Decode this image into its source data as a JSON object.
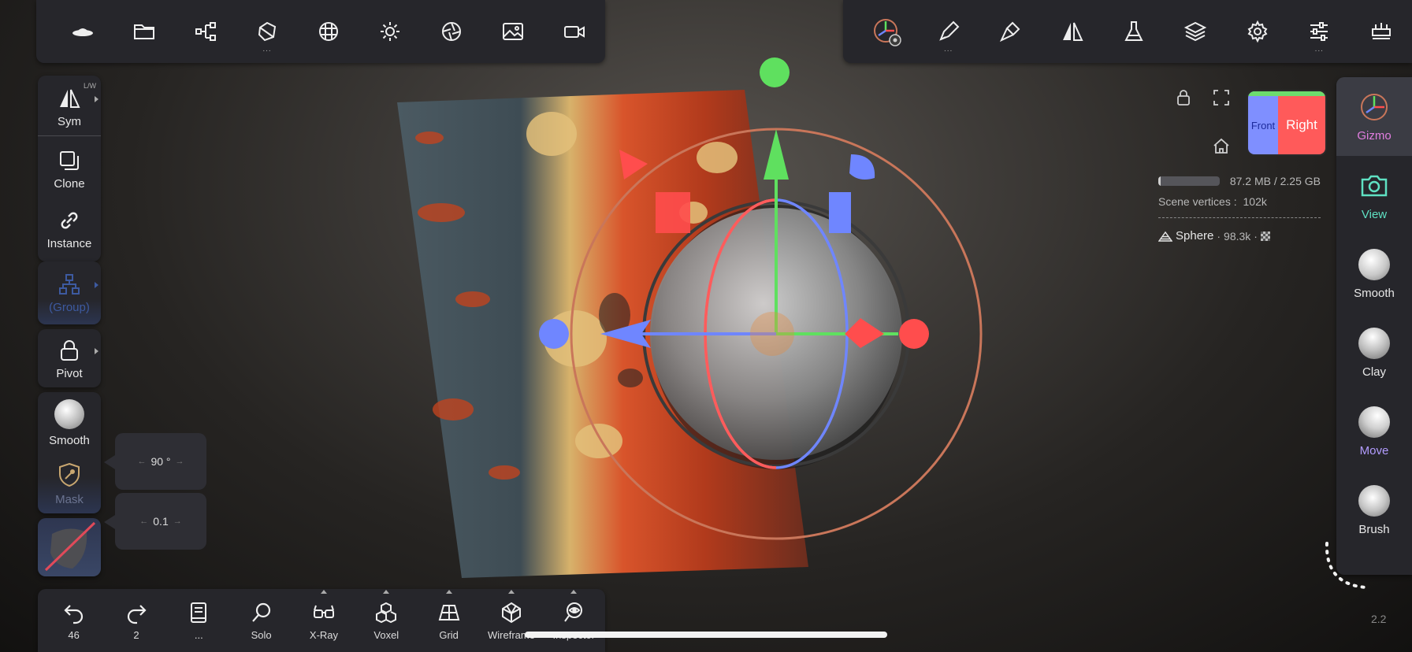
{
  "top_left_toolbar": {
    "items": [
      {
        "name": "scene-icon"
      },
      {
        "name": "folder-icon"
      },
      {
        "name": "node-graph-icon"
      },
      {
        "name": "topology-icon",
        "extra": "..."
      },
      {
        "name": "sphere-grid-icon"
      },
      {
        "name": "sun-icon"
      },
      {
        "name": "aperture-icon"
      },
      {
        "name": "image-icon"
      },
      {
        "name": "video-icon"
      }
    ]
  },
  "top_right_toolbar": {
    "items": [
      {
        "name": "gizmo-settings-icon"
      },
      {
        "name": "pen-icon",
        "extra": "..."
      },
      {
        "name": "brush-icon"
      },
      {
        "name": "symmetry-icon"
      },
      {
        "name": "flask-icon"
      },
      {
        "name": "layers-icon"
      },
      {
        "name": "gear-icon"
      },
      {
        "name": "sliders-icon",
        "extra": "..."
      },
      {
        "name": "more-tools-icon"
      }
    ]
  },
  "left_toolbar": {
    "sym": {
      "label": "Sym",
      "badge": "L/W"
    },
    "clone": {
      "label": "Clone"
    },
    "instance": {
      "label": "Instance"
    },
    "group": {
      "label": "(Group)"
    },
    "pivot": {
      "label": "Pivot"
    },
    "smooth": {
      "label": "Smooth"
    },
    "mask": {
      "label": "Mask"
    }
  },
  "popups": {
    "angle": {
      "value": "90 °"
    },
    "step": {
      "value": "0.1"
    }
  },
  "bottom_toolbar": {
    "undo": {
      "label": "46"
    },
    "redo": {
      "label": "2"
    },
    "history": {
      "label": "..."
    },
    "solo": {
      "label": "Solo"
    },
    "xray": {
      "label": "X-Ray"
    },
    "voxel": {
      "label": "Voxel"
    },
    "grid": {
      "label": "Grid"
    },
    "wireframe": {
      "label": "Wireframe"
    },
    "inspector": {
      "label": "Inspector"
    }
  },
  "right_toolbar": {
    "items": [
      {
        "label": "Gizmo",
        "color": "#e27ee0",
        "active": true
      },
      {
        "label": "View",
        "color": "#5fe1c3"
      },
      {
        "label": "Smooth",
        "color": "#e8e8e8"
      },
      {
        "label": "Clay",
        "color": "#e8e8e8"
      },
      {
        "label": "Move",
        "color": "#b29cff"
      },
      {
        "label": "Brush",
        "color": "#e8e8e8"
      }
    ]
  },
  "view_cube": {
    "front": "Front",
    "right": "Right"
  },
  "scene_info": {
    "memory": "87.2 MB / 2.25 GB",
    "memory_fraction": 0.04,
    "vertices_label": "Scene vertices :",
    "vertices_value": "102k",
    "object_name": "Sphere",
    "object_vertices": "98.3k"
  },
  "version": "2.2",
  "colors": {
    "x_axis": "#ff4d4d",
    "y_axis": "#5fe05f",
    "z_axis": "#6f86ff",
    "panel": "#26262b"
  }
}
